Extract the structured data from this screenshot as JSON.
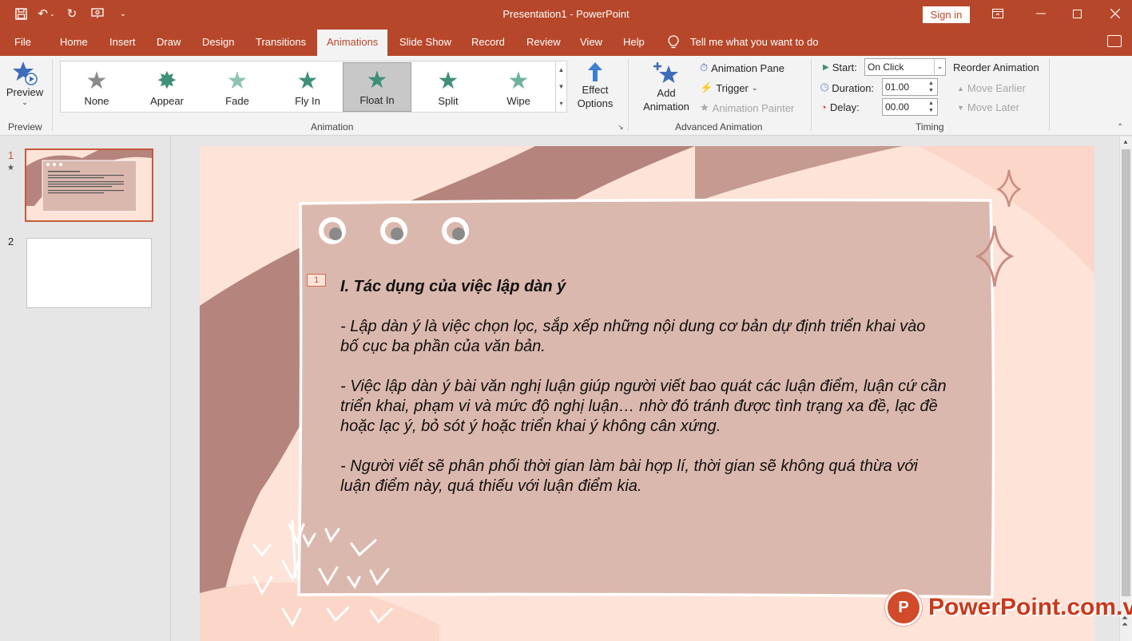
{
  "app": {
    "title": "Presentation1  -  PowerPoint",
    "sign_in": "Sign in"
  },
  "tabs": [
    "File",
    "Home",
    "Insert",
    "Draw",
    "Design",
    "Transitions",
    "Animations",
    "Slide Show",
    "Record",
    "Review",
    "View",
    "Help"
  ],
  "active_tab": "Animations",
  "tell_me": "Tell me what you want to do",
  "ribbon": {
    "preview": {
      "label": "Preview",
      "group": "Preview"
    },
    "animation": {
      "group": "Animation",
      "items": [
        {
          "label": "None",
          "color": "#8a8a8a"
        },
        {
          "label": "Appear",
          "color": "#3f8f7a"
        },
        {
          "label": "Fade",
          "color": "#8fc3b4"
        },
        {
          "label": "Fly In",
          "color": "#3f8f7a"
        },
        {
          "label": "Float In",
          "color": "#3f8f7a"
        },
        {
          "label": "Split",
          "color": "#3f8f7a"
        },
        {
          "label": "Wipe",
          "color": "#6fb09e"
        }
      ],
      "selected": "Float In",
      "effect_options": "Effect\nOptions"
    },
    "advanced": {
      "group": "Advanced Animation",
      "add_animation": "Add\nAnimation",
      "animation_pane": "Animation Pane",
      "trigger": "Trigger",
      "animation_painter": "Animation Painter"
    },
    "timing": {
      "group": "Timing",
      "start_label": "Start:",
      "start_value": "On Click",
      "duration_label": "Duration:",
      "duration_value": "01.00",
      "delay_label": "Delay:",
      "delay_value": "00.00",
      "reorder": "Reorder Animation",
      "move_earlier": "Move Earlier",
      "move_later": "Move Later"
    }
  },
  "slides_panel": {
    "slides": [
      {
        "number": "1"
      },
      {
        "number": "2"
      }
    ]
  },
  "slide": {
    "anim_tag": "1",
    "heading": "I. Tác dụng của việc lập dàn ý",
    "paragraphs": [
      "- Lập dàn ý là việc chọn lọc, sắp xếp những nội dung cơ bản dự định triển khai vào bố cục ba phần của văn bản.",
      "- Việc lập dàn ý bài văn nghị luận giúp người viết bao quát các luận điểm, luận cứ cần triển khai, phạm vi và mức độ nghị luận… nhờ đó tránh được tình trạng xa đề, lạc đề hoặc lạc ý, bỏ sót ý hoặc triển khai ý không cân xứng.",
      "- Người viết sẽ phân phối thời gian làm bài hợp lí, thời gian sẽ không quá thừa với luận điểm này, quá thiếu với luận điểm kia."
    ]
  },
  "watermark": {
    "logo": "P",
    "text": "PowerPoint.com.vn"
  },
  "colors": {
    "accent": "#b7472a",
    "slide_bg": "#fde3d8",
    "card": "#dbb8ad",
    "wave": "#b5857d"
  }
}
